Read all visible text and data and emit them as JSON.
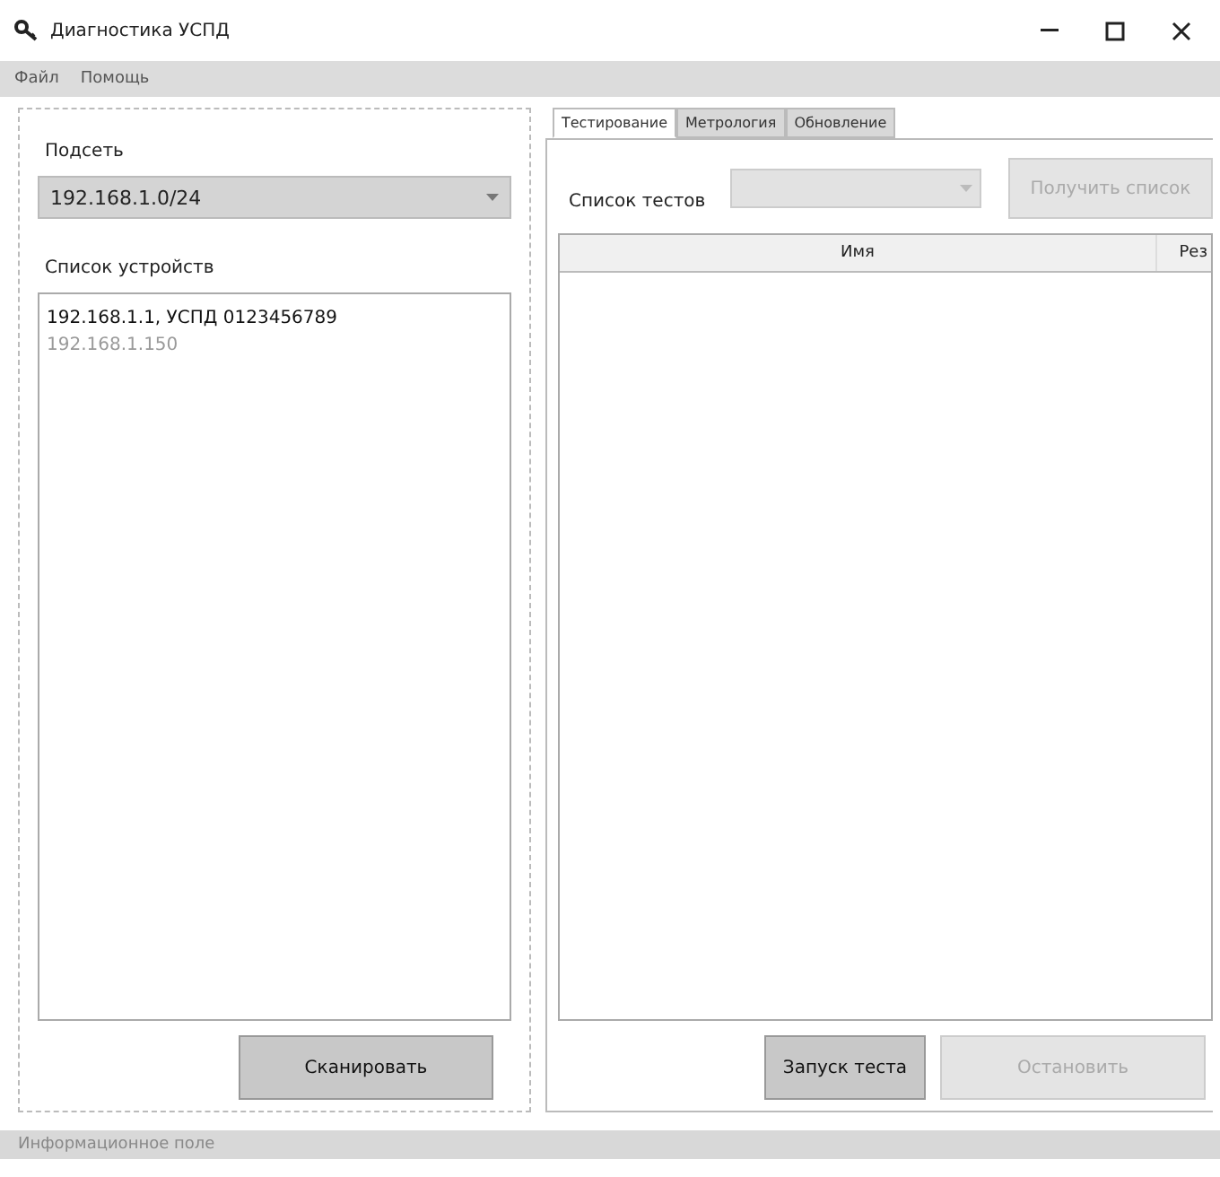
{
  "window": {
    "title": "Диагностика УСПД"
  },
  "menu": [
    "Файл",
    "Помощь"
  ],
  "left": {
    "subnet_label": "Подсеть",
    "subnet_value": "192.168.1.0/24",
    "devices_label": "Список устройств",
    "devices": [
      {
        "text": "192.168.1.1, УСПД 0123456789",
        "disabled": false
      },
      {
        "text": "192.168.1.150",
        "disabled": true
      }
    ],
    "scan_button": {
      "label": "Сканировать",
      "disabled": false
    }
  },
  "tabs": [
    {
      "label": "Тестирование",
      "selected": true
    },
    {
      "label": "Метрология",
      "selected": false
    },
    {
      "label": "Обновление",
      "selected": false
    }
  ],
  "tests": {
    "label": "Список тестов",
    "combo_disabled": true,
    "get_button": {
      "label": "Получить список",
      "disabled": true
    },
    "columns": [
      "Имя",
      "Рез"
    ],
    "buttons": [
      {
        "label": "Запуск теста",
        "disabled": false
      },
      {
        "label": "Остановить",
        "disabled": true
      }
    ]
  },
  "status_bar": "Информационное поле"
}
